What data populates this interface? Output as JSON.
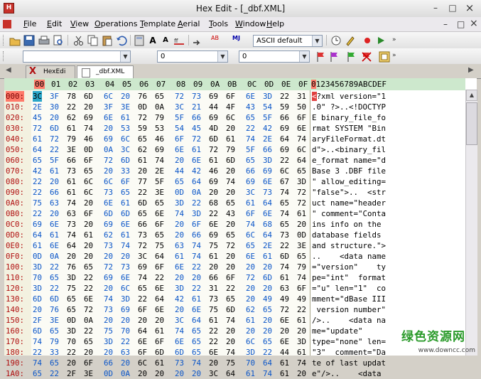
{
  "window": {
    "title": "Hex Edit - [_dbf.XML]",
    "icon_label": "H",
    "minimize": "–",
    "restore": "□",
    "close": "×"
  },
  "menu": {
    "items": [
      "File",
      "Edit",
      "View",
      "Operations",
      "Template",
      "Aerial",
      "Tools",
      "Window",
      "Help"
    ],
    "mdi_minimize": "–",
    "mdi_restore": "□",
    "mdi_close": "×"
  },
  "toolbar1": {
    "font_label_a": "A",
    "font_label_b": "A",
    "replace_label": "AB",
    "mj_label": "MJ",
    "charset": "ASCII default"
  },
  "toolbar2": {
    "find_value": "",
    "address_value": "0",
    "offset_value": "0"
  },
  "tabs": [
    {
      "label": "HexEdi",
      "icon": "hexedit-x-icon"
    },
    {
      "label": "_dbf.XML",
      "icon": "document-icon"
    }
  ],
  "ruler": {
    "hex": [
      "00",
      "01",
      "02",
      "03",
      "04",
      "05",
      "06",
      "07",
      "08",
      "09",
      "0A",
      "0B",
      "0C",
      "0D",
      "0E",
      "0F"
    ],
    "text": "0123456789ABCDEF",
    "text_selected_char": "0"
  },
  "rows": [
    {
      "offset": "000:",
      "hex": [
        "3C",
        "3F",
        "78",
        "6D",
        "6C",
        "20",
        "76",
        "65",
        "72",
        "73",
        "69",
        "6F",
        "6E",
        "3D",
        "22",
        "31"
      ],
      "text": "<?xml version=\"1"
    },
    {
      "offset": "010:",
      "hex": [
        "2E",
        "30",
        "22",
        "20",
        "3F",
        "3E",
        "0D",
        "0A",
        "3C",
        "21",
        "44",
        "4F",
        "43",
        "54",
        "59",
        "50"
      ],
      "text": ".0\" ?>..<!DOCTYP"
    },
    {
      "offset": "020:",
      "hex": [
        "45",
        "20",
        "62",
        "69",
        "6E",
        "61",
        "72",
        "79",
        "5F",
        "66",
        "69",
        "6C",
        "65",
        "5F",
        "66",
        "6F"
      ],
      "text": "E binary_file_fo"
    },
    {
      "offset": "030:",
      "hex": [
        "72",
        "6D",
        "61",
        "74",
        "20",
        "53",
        "59",
        "53",
        "54",
        "45",
        "4D",
        "20",
        "22",
        "42",
        "69",
        "6E"
      ],
      "text": "rmat SYSTEM \"Bin"
    },
    {
      "offset": "040:",
      "hex": [
        "61",
        "72",
        "79",
        "46",
        "69",
        "6C",
        "65",
        "46",
        "6F",
        "72",
        "6D",
        "61",
        "74",
        "2E",
        "64",
        "74"
      ],
      "text": "aryFileFormat.dt"
    },
    {
      "offset": "050:",
      "hex": [
        "64",
        "22",
        "3E",
        "0D",
        "0A",
        "3C",
        "62",
        "69",
        "6E",
        "61",
        "72",
        "79",
        "5F",
        "66",
        "69",
        "6C"
      ],
      "text": "d\">..<binary_fil"
    },
    {
      "offset": "060:",
      "hex": [
        "65",
        "5F",
        "66",
        "6F",
        "72",
        "6D",
        "61",
        "74",
        "20",
        "6E",
        "61",
        "6D",
        "65",
        "3D",
        "22",
        "64"
      ],
      "text": "e_format name=\"d"
    },
    {
      "offset": "070:",
      "hex": [
        "42",
        "61",
        "73",
        "65",
        "20",
        "33",
        "20",
        "2E",
        "44",
        "42",
        "46",
        "20",
        "66",
        "69",
        "6C",
        "65"
      ],
      "text": "Base 3 .DBF file"
    },
    {
      "offset": "080:",
      "hex": [
        "22",
        "20",
        "61",
        "6C",
        "6C",
        "6F",
        "77",
        "5F",
        "65",
        "64",
        "69",
        "74",
        "69",
        "6E",
        "67",
        "3D"
      ],
      "text": "\" allow_editing="
    },
    {
      "offset": "090:",
      "hex": [
        "22",
        "66",
        "61",
        "6C",
        "73",
        "65",
        "22",
        "3E",
        "0D",
        "0A",
        "20",
        "20",
        "3C",
        "73",
        "74",
        "72"
      ],
      "text": "\"false\">..  <str"
    },
    {
      "offset": "0A0:",
      "hex": [
        "75",
        "63",
        "74",
        "20",
        "6E",
        "61",
        "6D",
        "65",
        "3D",
        "22",
        "68",
        "65",
        "61",
        "64",
        "65",
        "72"
      ],
      "text": "uct name=\"header"
    },
    {
      "offset": "0B0:",
      "hex": [
        "22",
        "20",
        "63",
        "6F",
        "6D",
        "6D",
        "65",
        "6E",
        "74",
        "3D",
        "22",
        "43",
        "6F",
        "6E",
        "74",
        "61"
      ],
      "text": "\" comment=\"Conta"
    },
    {
      "offset": "0C0:",
      "hex": [
        "69",
        "6E",
        "73",
        "20",
        "69",
        "6E",
        "66",
        "6F",
        "20",
        "6F",
        "6E",
        "20",
        "74",
        "68",
        "65",
        "20"
      ],
      "text": "ins info on the "
    },
    {
      "offset": "0D0:",
      "hex": [
        "64",
        "61",
        "74",
        "61",
        "62",
        "61",
        "73",
        "65",
        "20",
        "66",
        "69",
        "65",
        "6C",
        "64",
        "73",
        "0D"
      ],
      "text": "database fields "
    },
    {
      "offset": "0E0:",
      "hex": [
        "61",
        "6E",
        "64",
        "20",
        "73",
        "74",
        "72",
        "75",
        "63",
        "74",
        "75",
        "72",
        "65",
        "2E",
        "22",
        "3E"
      ],
      "text": "and structure.\">"
    },
    {
      "offset": "0F0:",
      "hex": [
        "0D",
        "0A",
        "20",
        "20",
        "20",
        "20",
        "3C",
        "64",
        "61",
        "74",
        "61",
        "20",
        "6E",
        "61",
        "6D",
        "65"
      ],
      "text": "..    <data name"
    },
    {
      "offset": "100:",
      "hex": [
        "3D",
        "22",
        "76",
        "65",
        "72",
        "73",
        "69",
        "6F",
        "6E",
        "22",
        "20",
        "20",
        "20",
        "20",
        "74",
        "79"
      ],
      "text": "=\"version\"    ty"
    },
    {
      "offset": "110:",
      "hex": [
        "70",
        "65",
        "3D",
        "22",
        "69",
        "6E",
        "74",
        "22",
        "20",
        "20",
        "66",
        "6F",
        "72",
        "6D",
        "61",
        "74"
      ],
      "text": "pe=\"int\"  format"
    },
    {
      "offset": "120:",
      "hex": [
        "3D",
        "22",
        "75",
        "22",
        "20",
        "6C",
        "65",
        "6E",
        "3D",
        "22",
        "31",
        "22",
        "20",
        "20",
        "63",
        "6F"
      ],
      "text": "=\"u\" len=\"1\"  co"
    },
    {
      "offset": "130:",
      "hex": [
        "6D",
        "6D",
        "65",
        "6E",
        "74",
        "3D",
        "22",
        "64",
        "42",
        "61",
        "73",
        "65",
        "20",
        "49",
        "49",
        "49"
      ],
      "text": "mment=\"dBase III"
    },
    {
      "offset": "140:",
      "hex": [
        "20",
        "76",
        "65",
        "72",
        "73",
        "69",
        "6F",
        "6E",
        "20",
        "6E",
        "75",
        "6D",
        "62",
        "65",
        "72",
        "22"
      ],
      "text": " version number\""
    },
    {
      "offset": "150:",
      "hex": [
        "2F",
        "3E",
        "0D",
        "0A",
        "20",
        "20",
        "20",
        "20",
        "3C",
        "64",
        "61",
        "74",
        "61",
        "20",
        "6E",
        "61"
      ],
      "text": "/>..    <data na"
    },
    {
      "offset": "160:",
      "hex": [
        "6D",
        "65",
        "3D",
        "22",
        "75",
        "70",
        "64",
        "61",
        "74",
        "65",
        "22",
        "20",
        "20",
        "20",
        "20",
        "20"
      ],
      "text": "me=\"update\"     "
    },
    {
      "offset": "170:",
      "hex": [
        "74",
        "79",
        "70",
        "65",
        "3D",
        "22",
        "6E",
        "6F",
        "6E",
        "65",
        "22",
        "20",
        "6C",
        "65",
        "6E",
        "3D"
      ],
      "text": "type=\"none\" len="
    },
    {
      "offset": "180:",
      "hex": [
        "22",
        "33",
        "22",
        "20",
        "20",
        "63",
        "6F",
        "6D",
        "6D",
        "65",
        "6E",
        "74",
        "3D",
        "22",
        "44",
        "61"
      ],
      "text": "\"3\"  comment=\"Da"
    },
    {
      "offset": "190:",
      "hex": [
        "74",
        "65",
        "20",
        "6F",
        "66",
        "20",
        "6C",
        "61",
        "73",
        "74",
        "20",
        "75",
        "70",
        "64",
        "61",
        "74"
      ],
      "text": "te of last updat"
    },
    {
      "offset": "1A0:",
      "hex": [
        "65",
        "22",
        "2F",
        "3E",
        "0D",
        "0A",
        "20",
        "20",
        "20",
        "20",
        "3C",
        "64",
        "61",
        "74",
        "61",
        "20"
      ],
      "text": "e\"/>..    <data "
    }
  ],
  "selection": {
    "offset": "000:",
    "cell": "3C",
    "text_char": "<"
  },
  "colors": {
    "offset_text": "#b01010",
    "hex_even": "#000000",
    "hex_odd": "#0a55c8",
    "selected_cell": "#2aa6c8",
    "selected_text": "#e04040",
    "ruler_bg": "#cde8cd",
    "ruler_selected": "#ff7a6a"
  },
  "watermark": {
    "title": "绿色资源网",
    "url": "www.downcc.com"
  }
}
